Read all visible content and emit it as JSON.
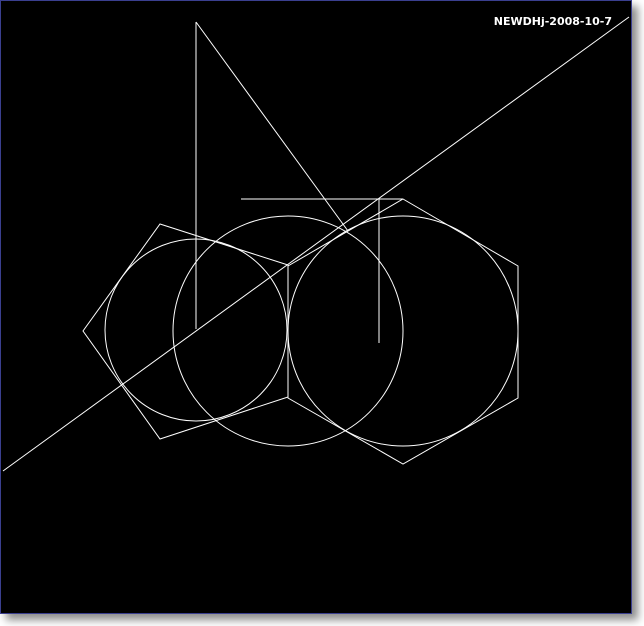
{
  "drawing": {
    "label": "NEWDHj-2008-10-7",
    "line_color": "#ffffff",
    "background_color": "#000000",
    "border_color": "#3a3f8f"
  }
}
